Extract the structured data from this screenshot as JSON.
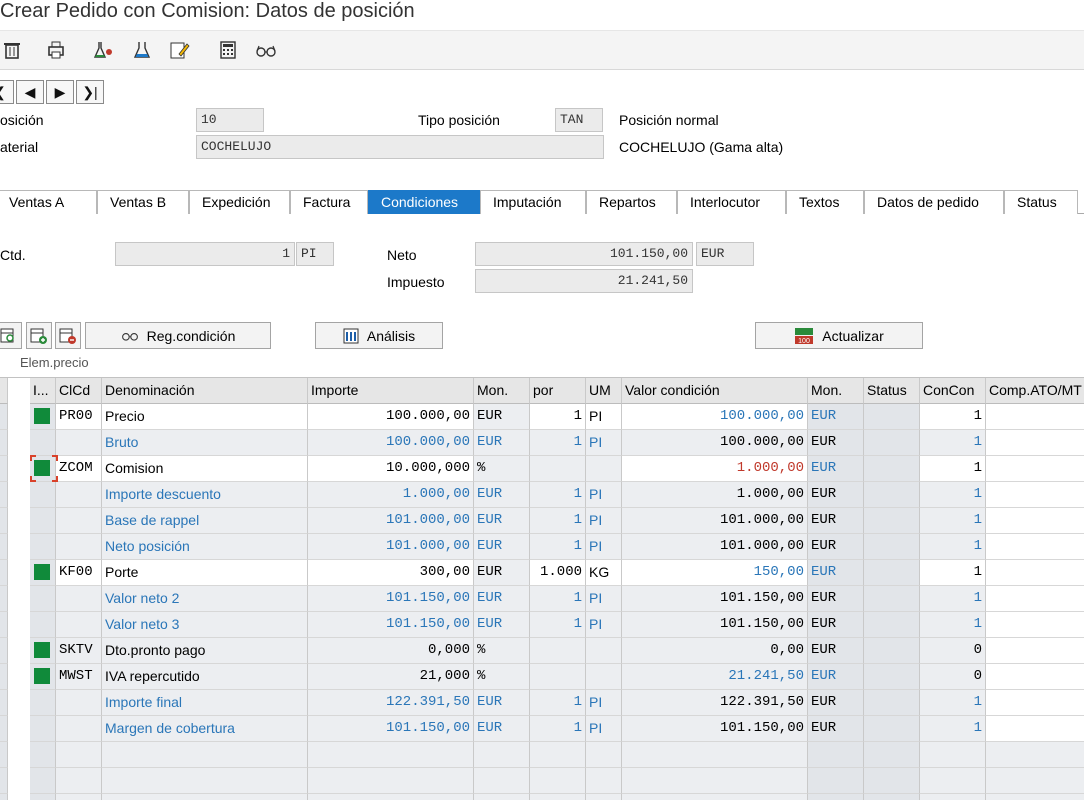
{
  "title": "Crear Pedido con Comision: Datos de posición",
  "toolbar": {
    "icons": [
      "trash-icon",
      "print-icon",
      "flask-icon",
      "flask-small-icon",
      "edit-note-icon",
      "calculator-icon",
      "glasses-icon"
    ]
  },
  "nav": [
    "|<",
    "<",
    ">",
    ">|"
  ],
  "header": {
    "posicion_label": "osición",
    "posicion_value": "10",
    "tipo_label": "Tipo posición",
    "tipo_value": "TAN",
    "tipo_desc": "Posición normal",
    "material_label": "aterial",
    "material_value": "COCHELUJO",
    "material_desc": "COCHELUJO (Gama alta)"
  },
  "tabs": [
    "Ventas A",
    "Ventas B",
    "Expedición",
    "Factura",
    "Condiciones",
    "Imputación",
    "Repartos",
    "Interlocutor",
    "Textos",
    "Datos de pedido",
    "Status"
  ],
  "active_tab": "Condiciones",
  "quantity": {
    "ctd_label": "Ctd.",
    "ctd_value": "1",
    "ctd_unit": "PI",
    "neto_label": "Neto",
    "neto_value": "101.150,00",
    "neto_currency": "EUR",
    "impuesto_label": "Impuesto",
    "impuesto_value": "21.241,50"
  },
  "buttons": {
    "reg_condicion": "Reg.condición",
    "analisis": "Análisis",
    "actualizar": "Actualizar"
  },
  "grid_label": "Elem.precio",
  "columns": [
    "I...",
    "ClCd",
    "Denominación",
    "Importe",
    "Mon.",
    "por",
    "UM",
    "Valor condición",
    "Mon.",
    "Status",
    "ConCon",
    "Comp.ATO/MT"
  ],
  "rows": [
    {
      "sq": true,
      "clcd": "PR00",
      "denom": "Precio",
      "importe": "100.000,00",
      "mon": "EUR",
      "por": "1",
      "um": "PI",
      "valor": "100.000,00",
      "mon2": "EUR",
      "concon": "1",
      "style": "white",
      "denomColor": "",
      "importeColor": "",
      "valorColor": "blue"
    },
    {
      "sq": false,
      "clcd": "",
      "denom": "Bruto",
      "importe": "100.000,00",
      "mon": "EUR",
      "por": "1",
      "um": "PI",
      "valor": "100.000,00",
      "mon2": "EUR",
      "concon": "1",
      "style": "grey",
      "denomColor": "blue",
      "importeColor": "blue",
      "valorColor": ""
    },
    {
      "sq": true,
      "clcd": "ZCOM",
      "denom": "Comision",
      "importe": "10.000,000",
      "mon": "%",
      "por": "",
      "um": "",
      "valor": "1.000,00",
      "mon2": "EUR",
      "concon": "1",
      "style": "white",
      "denomColor": "",
      "importeColor": "",
      "valorColor": "red"
    },
    {
      "sq": false,
      "clcd": "",
      "denom": "Importe descuento",
      "importe": "1.000,00",
      "mon": "EUR",
      "por": "1",
      "um": "PI",
      "valor": "1.000,00",
      "mon2": "EUR",
      "concon": "1",
      "style": "grey",
      "denomColor": "blue",
      "importeColor": "blue",
      "valorColor": ""
    },
    {
      "sq": false,
      "clcd": "",
      "denom": "Base de rappel",
      "importe": "101.000,00",
      "mon": "EUR",
      "por": "1",
      "um": "PI",
      "valor": "101.000,00",
      "mon2": "EUR",
      "concon": "1",
      "style": "grey",
      "denomColor": "blue",
      "importeColor": "blue",
      "valorColor": ""
    },
    {
      "sq": false,
      "clcd": "",
      "denom": "Neto posición",
      "importe": "101.000,00",
      "mon": "EUR",
      "por": "1",
      "um": "PI",
      "valor": "101.000,00",
      "mon2": "EUR",
      "concon": "1",
      "style": "grey",
      "denomColor": "blue",
      "importeColor": "blue",
      "valorColor": ""
    },
    {
      "sq": true,
      "clcd": "KF00",
      "denom": "Porte",
      "importe": "300,00",
      "mon": "EUR",
      "por": "1.000",
      "um": "KG",
      "valor": "150,00",
      "mon2": "EUR",
      "concon": "1",
      "style": "white",
      "denomColor": "",
      "importeColor": "",
      "valorColor": "blue"
    },
    {
      "sq": false,
      "clcd": "",
      "denom": "Valor neto 2",
      "importe": "101.150,00",
      "mon": "EUR",
      "por": "1",
      "um": "PI",
      "valor": "101.150,00",
      "mon2": "EUR",
      "concon": "1",
      "style": "grey",
      "denomColor": "blue",
      "importeColor": "blue",
      "valorColor": ""
    },
    {
      "sq": false,
      "clcd": "",
      "denom": "Valor neto 3",
      "importe": "101.150,00",
      "mon": "EUR",
      "por": "1",
      "um": "PI",
      "valor": "101.150,00",
      "mon2": "EUR",
      "concon": "1",
      "style": "grey",
      "denomColor": "blue",
      "importeColor": "blue",
      "valorColor": ""
    },
    {
      "sq": true,
      "clcd": "SKTV",
      "denom": "Dto.pronto pago",
      "importe": "0,000",
      "mon": "%",
      "por": "",
      "um": "",
      "valor": "0,00",
      "mon2": "EUR",
      "concon": "0",
      "style": "grey",
      "denomColor": "",
      "importeColor": "",
      "valorColor": ""
    },
    {
      "sq": true,
      "clcd": "MWST",
      "denom": "IVA repercutido",
      "importe": "21,000",
      "mon": "%",
      "por": "",
      "um": "",
      "valor": "21.241,50",
      "mon2": "EUR",
      "concon": "0",
      "style": "grey",
      "denomColor": "",
      "importeColor": "",
      "valorColor": "blue"
    },
    {
      "sq": false,
      "clcd": "",
      "denom": "Importe final",
      "importe": "122.391,50",
      "mon": "EUR",
      "por": "1",
      "um": "PI",
      "valor": "122.391,50",
      "mon2": "EUR",
      "concon": "1",
      "style": "grey",
      "denomColor": "blue",
      "importeColor": "blue",
      "valorColor": ""
    },
    {
      "sq": false,
      "clcd": "",
      "denom": "Margen de cobertura",
      "importe": "101.150,00",
      "mon": "EUR",
      "por": "1",
      "um": "PI",
      "valor": "101.150,00",
      "mon2": "EUR",
      "concon": "1",
      "style": "grey",
      "denomColor": "blue",
      "importeColor": "blue",
      "valorColor": ""
    }
  ]
}
